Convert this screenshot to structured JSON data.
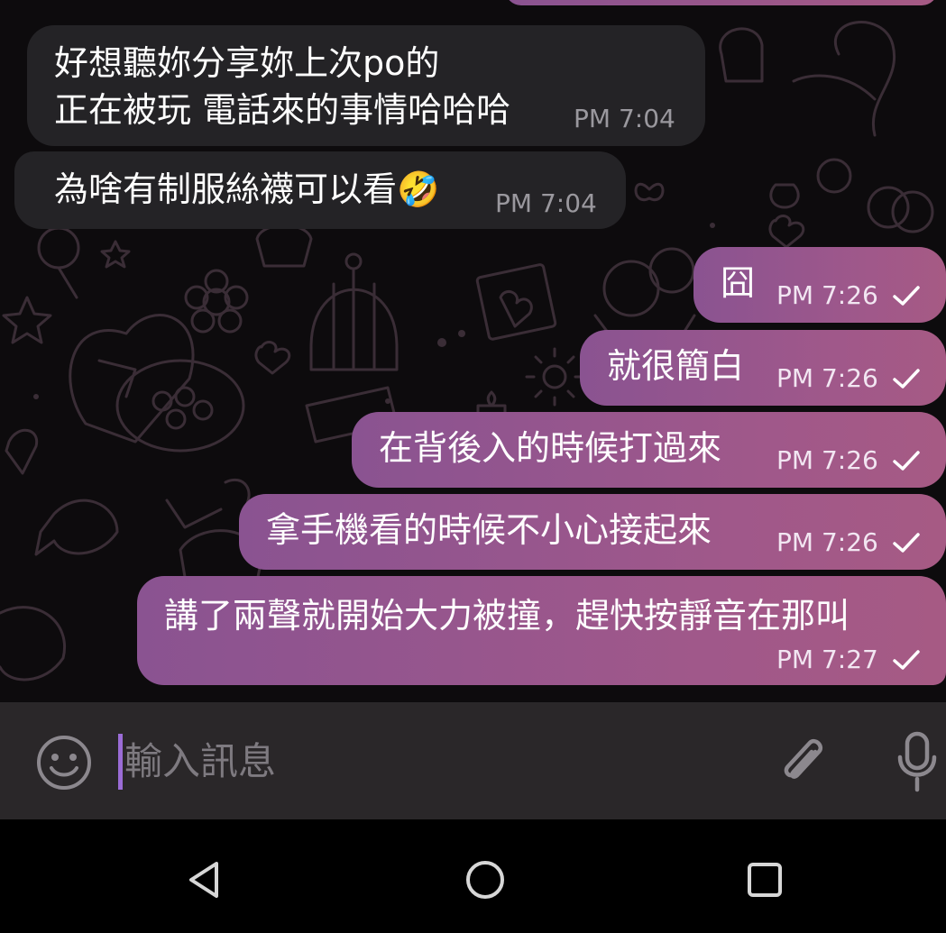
{
  "messages": [
    {
      "direction": "incoming",
      "lines": [
        "好想聽妳分享妳上次po的",
        "正在被玩 電話來的事情哈哈哈"
      ],
      "time": "PM 7:04"
    },
    {
      "direction": "incoming",
      "lines": [
        "為啥有制服絲襪可以看🤣"
      ],
      "time": "PM 7:04"
    },
    {
      "direction": "outgoing",
      "lines": [
        "囧"
      ],
      "time": "PM 7:26",
      "status": "sent"
    },
    {
      "direction": "outgoing",
      "lines": [
        "就很簡白"
      ],
      "time": "PM 7:26",
      "status": "sent"
    },
    {
      "direction": "outgoing",
      "lines": [
        "在背後入的時候打過來"
      ],
      "time": "PM 7:26",
      "status": "sent"
    },
    {
      "direction": "outgoing",
      "lines": [
        "拿手機看的時候不小心接起來"
      ],
      "time": "PM 7:26",
      "status": "sent"
    },
    {
      "direction": "outgoing",
      "lines": [
        "講了兩聲就開始大力被撞，趕快按靜音在那叫"
      ],
      "time": "PM 7:27",
      "status": "sent"
    }
  ],
  "composer": {
    "placeholder": "輸入訊息",
    "emoji_icon": "emoji-icon",
    "attach_icon": "paperclip-icon",
    "mic_icon": "microphone-icon"
  },
  "navigation": {
    "back_icon": "back-triangle-icon",
    "home_icon": "home-circle-icon",
    "recents_icon": "recents-square-icon"
  },
  "colors": {
    "chat_background": "#0d0b0d",
    "incoming_bubble": "#242326",
    "outgoing_bubble_start": "#8a5391",
    "outgoing_bubble_end": "#a65a84",
    "caret": "#9b6cd6",
    "input_bar": "#2a2729"
  }
}
